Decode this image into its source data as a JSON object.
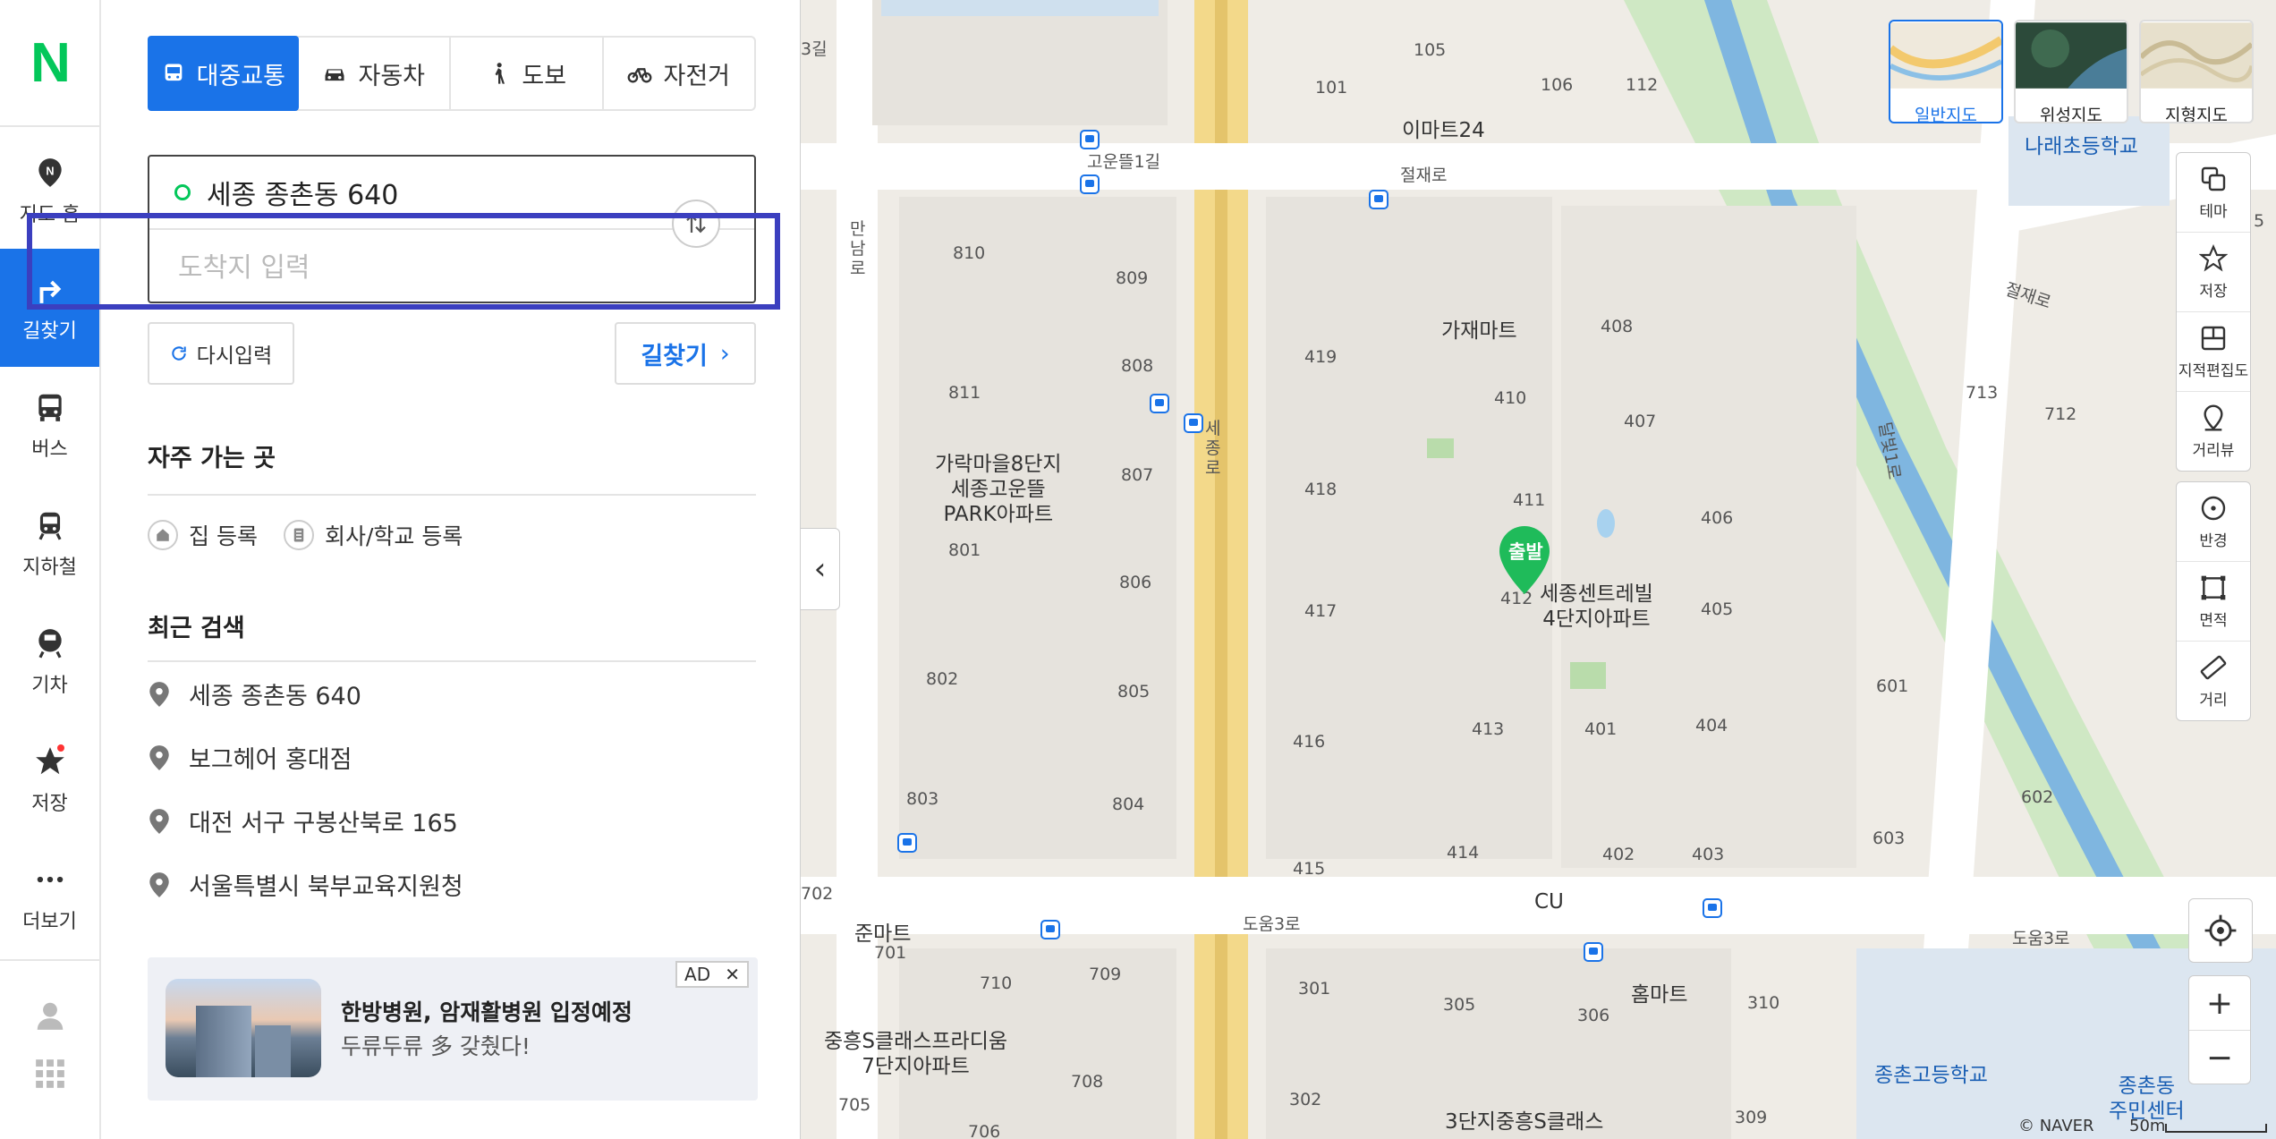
{
  "app": {
    "logo": "N"
  },
  "nav": {
    "items": [
      {
        "label": "지도 홈"
      },
      {
        "label": "길찾기"
      },
      {
        "label": "버스"
      },
      {
        "label": "지하철"
      },
      {
        "label": "기차"
      },
      {
        "label": "저장"
      },
      {
        "label": "더보기"
      }
    ]
  },
  "modes": {
    "transit": "대중교통",
    "car": "자동차",
    "walk": "도보",
    "bike": "자전거"
  },
  "route": {
    "start_value": "세종 종촌동 640",
    "end_placeholder": "도착지 입력",
    "end_value": ""
  },
  "actions": {
    "reset": "다시입력",
    "find": "길찾기"
  },
  "frequent": {
    "title": "자주 가는 곳",
    "home": "집 등록",
    "work": "회사/학교 등록"
  },
  "recent": {
    "title": "최근 검색",
    "items": [
      "세종 종촌동 640",
      "보그헤어 홍대점",
      "대전 서구 구봉산북로 165",
      "서울특별시 북부교육지원청"
    ]
  },
  "ad": {
    "badge": "AD",
    "close": "✕",
    "title": "한방병원, 암재활병원 입정예정",
    "subtitle": "두류두류 多 갖췄다!"
  },
  "map": {
    "layers": [
      "일반지도",
      "위성지도",
      "지형지도"
    ],
    "tools": [
      "테마",
      "저장",
      "지적편집도",
      "거리뷰",
      "반경",
      "면적",
      "거리"
    ],
    "start_pin": "출발",
    "copyright": "© NAVER",
    "scale": "50m",
    "labels": {
      "l3gil": "3길",
      "n105": "105",
      "n101": "101",
      "n106": "106",
      "n112": "112",
      "emart24": "이마트24",
      "naraedong": "나래초등학교",
      "goundduel1": "고운뜰1길",
      "jeoljaero1": "절재로",
      "jeoljaero2": "절재로",
      "mandalro": "만남로",
      "n810": "810",
      "n809": "809",
      "n811": "811",
      "n808": "808",
      "garak": "가락마을8단지\n세종고운뜰\nPARK아파트",
      "n807": "807",
      "n801": "801",
      "n806": "806",
      "n802": "802",
      "n805": "805",
      "n803": "803",
      "n804": "804",
      "sejongro": "세종로",
      "gajaemart": "가재마트",
      "n419": "419",
      "n408": "408",
      "n410": "410",
      "n407": "407",
      "n418": "418",
      "n411": "411",
      "n406": "406",
      "n417": "417",
      "n412": "412",
      "n405": "405",
      "n416": "416",
      "n413": "413",
      "n401": "401",
      "n404": "404",
      "n414": "414",
      "n402": "402",
      "n403": "403",
      "n415": "415",
      "centreville": "세종센트레빌\n4단지아파트",
      "cu": "CU",
      "doum3ro1": "도움3로",
      "doum3ro2": "도움3로",
      "junmart": "준마트",
      "n702": "702",
      "n701": "701",
      "n710": "710",
      "n709": "709",
      "n708": "708",
      "n705": "705",
      "n706": "706",
      "jungheung7": "중흥S클래스프라디움\n7단지아파트",
      "homemart": "홈마트",
      "n301": "301",
      "n305": "305",
      "n306": "306",
      "n310": "310",
      "n302": "302",
      "n309": "309",
      "jungheung3": "3단지중흥S클래스",
      "n713": "713",
      "n712": "712",
      "n601": "601",
      "n602": "602",
      "n603": "603",
      "dalbit1ro": "달빛1로",
      "jongchon_high": "종촌고등학교",
      "jongchon_center": "종촌동\n주민센터",
      "n5": "5"
    }
  }
}
